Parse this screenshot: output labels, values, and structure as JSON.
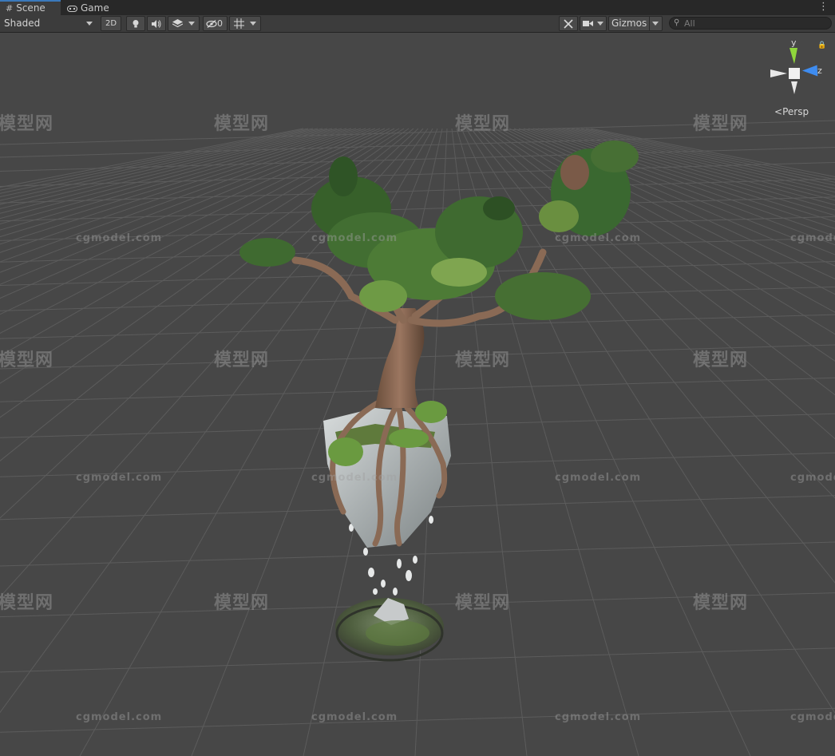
{
  "tabs": [
    {
      "label": "Scene",
      "icon": "grid-icon",
      "active": true
    },
    {
      "label": "Game",
      "icon": "gamepad-icon",
      "active": false
    }
  ],
  "toolbar": {
    "shading_mode": "Shaded",
    "mode_2d": "2D",
    "hidden_count": "0",
    "gizmos_label": "Gizmos",
    "search_placeholder": "All"
  },
  "scene_gizmo": {
    "axis_y": "y",
    "axis_z": "z",
    "projection": "Persp"
  },
  "watermark": {
    "site": "cgmodel.com",
    "brand": "模型网"
  },
  "colors": {
    "accent": "#3a79bb",
    "axis_y": "#8fd63b",
    "axis_z": "#3e8cf0",
    "viewport_bg": "#474747"
  }
}
